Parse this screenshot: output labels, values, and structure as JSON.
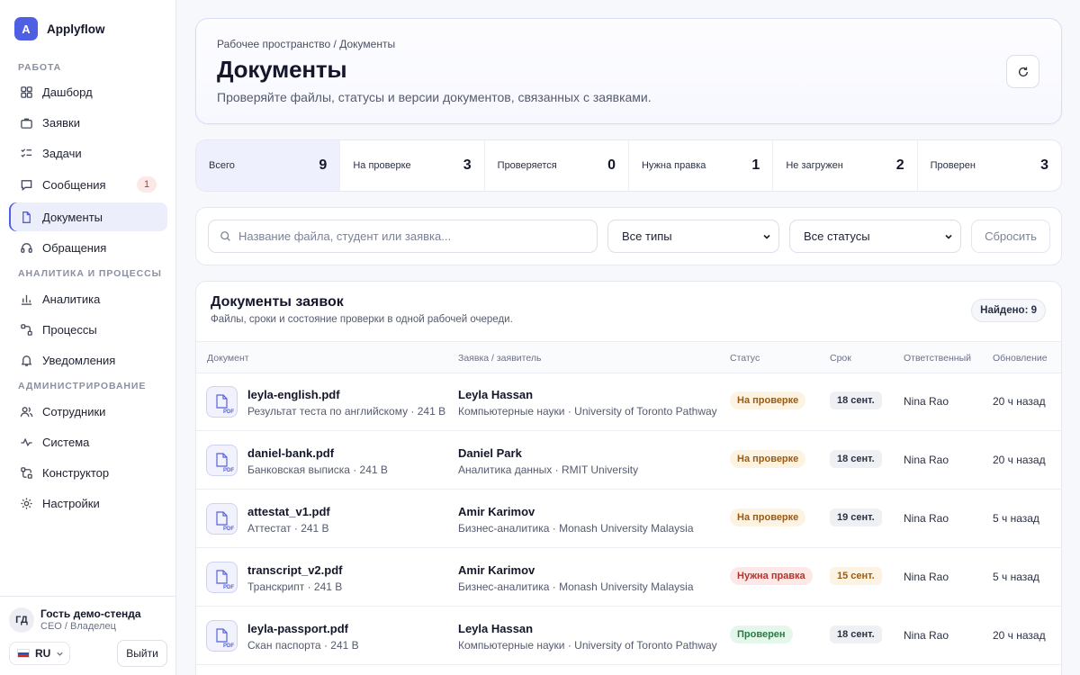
{
  "brand": {
    "logo_letter": "A",
    "name": "Applyflow"
  },
  "sidebar": {
    "sections": [
      {
        "title": "Работа"
      },
      {
        "title": "Аналитика и процессы"
      },
      {
        "title": "Администрирование"
      }
    ],
    "items": [
      {
        "label": "Дашборд",
        "icon": "dashboard-icon"
      },
      {
        "label": "Заявки",
        "icon": "briefcase-icon"
      },
      {
        "label": "Задачи",
        "icon": "checklist-icon"
      },
      {
        "label": "Сообщения",
        "icon": "message-icon",
        "badge": "1"
      },
      {
        "label": "Документы",
        "icon": "document-icon",
        "active": true
      },
      {
        "label": "Обращения",
        "icon": "headset-icon"
      },
      {
        "label": "Аналитика",
        "icon": "bar-chart-icon"
      },
      {
        "label": "Процессы",
        "icon": "workflow-icon"
      },
      {
        "label": "Уведомления",
        "icon": "bell-icon"
      },
      {
        "label": "Сотрудники",
        "icon": "users-icon"
      },
      {
        "label": "Система",
        "icon": "activity-icon"
      },
      {
        "label": "Конструктор",
        "icon": "builder-icon"
      },
      {
        "label": "Настройки",
        "icon": "settings-icon"
      }
    ],
    "user": {
      "initials": "ГД",
      "name": "Гость демо-стенда",
      "role": "CEO / Владелец"
    },
    "language": "RU",
    "logout_label": "Выйти"
  },
  "header": {
    "breadcrumb": "Рабочее пространство / Документы",
    "title": "Документы",
    "subtitle": "Проверяйте файлы, статусы и версии документов, связанных с заявками."
  },
  "stats": [
    {
      "label": "Всего",
      "value": "9"
    },
    {
      "label": "На проверке",
      "value": "3"
    },
    {
      "label": "Проверяется",
      "value": "0"
    },
    {
      "label": "Нужна правка",
      "value": "1"
    },
    {
      "label": "Не загружен",
      "value": "2"
    },
    {
      "label": "Проверен",
      "value": "3"
    }
  ],
  "filters": {
    "search_placeholder": "Название файла, студент или заявка...",
    "type_select": "Все типы",
    "status_select": "Все статусы",
    "reset_label": "Сбросить"
  },
  "table": {
    "title": "Документы заявок",
    "subtitle": "Файлы, сроки и состояние проверки в одной рабочей очереди.",
    "found": "Найдено: 9",
    "columns": [
      "Документ",
      "Заявка / заявитель",
      "Статус",
      "Срок",
      "Ответственный",
      "Обновление"
    ],
    "file_ext": "PDF",
    "rows": [
      {
        "file": "leyla-english.pdf",
        "meta": "Результат теста по английскому · 241 B",
        "applicant": "Leyla Hassan",
        "program": "Компьютерные науки · University of Toronto Pathway",
        "status": "На проверке",
        "deadline": "18 сент.",
        "owner": "Nina Rao",
        "updated": "20 ч назад"
      },
      {
        "file": "daniel-bank.pdf",
        "meta": "Банковская выписка · 241 B",
        "applicant": "Daniel Park",
        "program": "Аналитика данных · RMIT University",
        "status": "На проверке",
        "deadline": "18 сент.",
        "owner": "Nina Rao",
        "updated": "20 ч назад"
      },
      {
        "file": "attestat_v1.pdf",
        "meta": "Аттестат · 241 B",
        "applicant": "Amir Karimov",
        "program": "Бизнес-аналитика · Monash University Malaysia",
        "status": "На проверке",
        "deadline": "19 сент.",
        "owner": "Nina Rao",
        "updated": "5 ч назад"
      },
      {
        "file": "transcript_v2.pdf",
        "meta": "Транскрипт · 241 B",
        "applicant": "Amir Karimov",
        "program": "Бизнес-аналитика · Monash University Malaysia",
        "status": "Нужна правка",
        "deadline": "15 сент.",
        "owner": "Nina Rao",
        "updated": "5 ч назад"
      },
      {
        "file": "leyla-passport.pdf",
        "meta": "Скан паспорта · 241 B",
        "applicant": "Leyla Hassan",
        "program": "Компьютерные науки · University of Toronto Pathway",
        "status": "Проверен",
        "deadline": "18 сент.",
        "owner": "Nina Rao",
        "updated": "20 ч назад"
      }
    ]
  },
  "colors": {
    "accent": "#4f5fe3",
    "review": "#9a5b12",
    "fix": "#b4332b",
    "ok": "#2b7a45"
  }
}
